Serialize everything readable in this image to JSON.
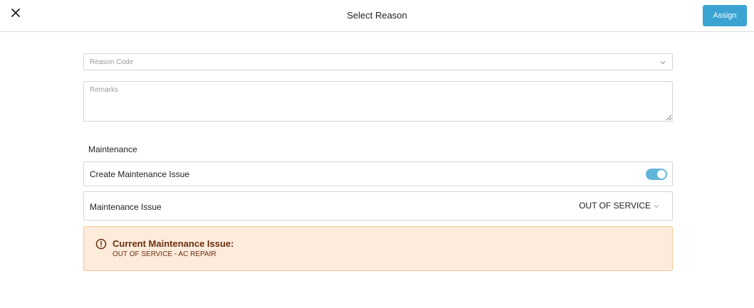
{
  "header": {
    "title": "Select Reason",
    "assign_label": "Assign",
    "close_icon": "close-icon"
  },
  "form": {
    "reason_code": {
      "placeholder": "Reason Code",
      "value": ""
    },
    "remarks": {
      "placeholder": "Remarks",
      "value": ""
    }
  },
  "maintenance": {
    "section_title": "Maintenance",
    "create_issue_label": "Create Maintenance Issue",
    "create_issue_enabled": true,
    "issue_label": "Maintenance Issue",
    "issue_value": "OUT OF SERVICE"
  },
  "alert": {
    "title": "Current Maintenance Issue:",
    "text": "OUT OF SERVICE - AC REPAIR",
    "icon": "alert-circle-icon"
  },
  "colors": {
    "accent": "#3aa3d1",
    "toggle_on": "#62b4d9",
    "alert_bg": "#fdebdc",
    "alert_border": "#f5c69b",
    "alert_text": "#6b2e0e"
  }
}
